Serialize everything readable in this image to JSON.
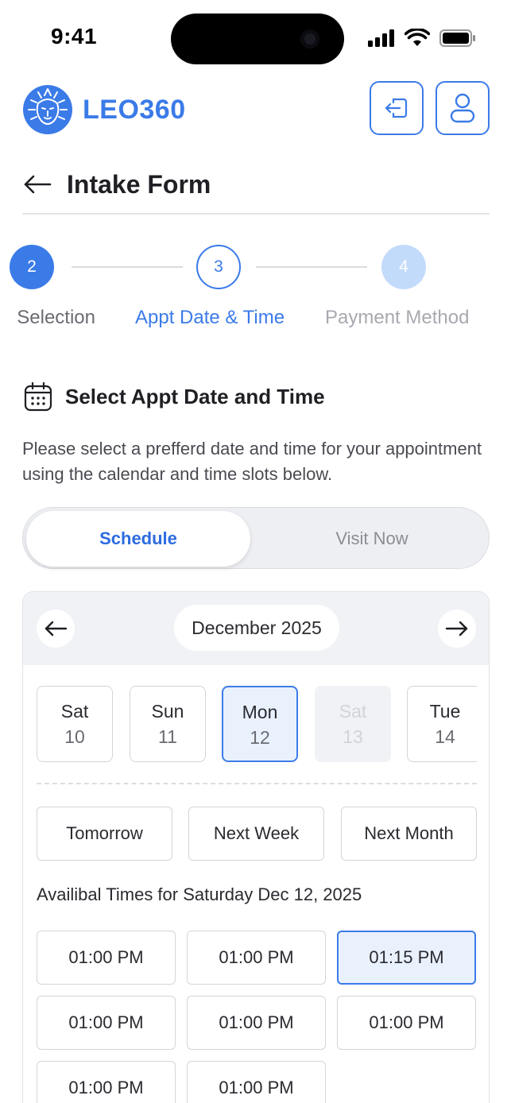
{
  "status_bar": {
    "time": "9:41"
  },
  "header": {
    "brand": "LEO360"
  },
  "page": {
    "title": "Intake Form"
  },
  "stepper": {
    "steps": [
      {
        "number": "2",
        "label": "Selection",
        "state": "done"
      },
      {
        "number": "3",
        "label": "Appt Date & Time",
        "state": "active"
      },
      {
        "number": "4",
        "label": "Payment Method",
        "state": "upcoming"
      }
    ]
  },
  "section": {
    "title": "Select Appt Date and Time",
    "description": "Please select a prefferd date and time for your appointment using the calendar and time slots below."
  },
  "toggle": {
    "schedule_label": "Schedule",
    "visit_now_label": "Visit Now",
    "selected": "Schedule"
  },
  "calendar": {
    "month": "December 2025",
    "days": [
      {
        "name": "Sat",
        "date": "10",
        "state": "normal"
      },
      {
        "name": "Sun",
        "date": "11",
        "state": "normal"
      },
      {
        "name": "Mon",
        "date": "12",
        "state": "selected"
      },
      {
        "name": "Sat",
        "date": "13",
        "state": "disabled"
      },
      {
        "name": "Tue",
        "date": "14",
        "state": "normal"
      }
    ],
    "quick_picks": [
      "Tomorrow",
      "Next Week",
      "Next Month"
    ],
    "available_label": "Availibal Times for Saturday Dec 12, 2025",
    "slots": [
      {
        "time": "01:00 PM",
        "selected": false
      },
      {
        "time": "01:00 PM",
        "selected": false
      },
      {
        "time": "01:15 PM",
        "selected": true
      },
      {
        "time": "01:00 PM",
        "selected": false
      },
      {
        "time": "01:00 PM",
        "selected": false
      },
      {
        "time": "01:00 PM",
        "selected": false
      },
      {
        "time": "01:00 PM",
        "selected": false
      },
      {
        "time": "01:00 PM",
        "selected": false
      }
    ]
  },
  "colors": {
    "accent": "#3b7be8",
    "accent_light": "#e9f1fd",
    "step_upcoming": "#c3dbfb"
  }
}
